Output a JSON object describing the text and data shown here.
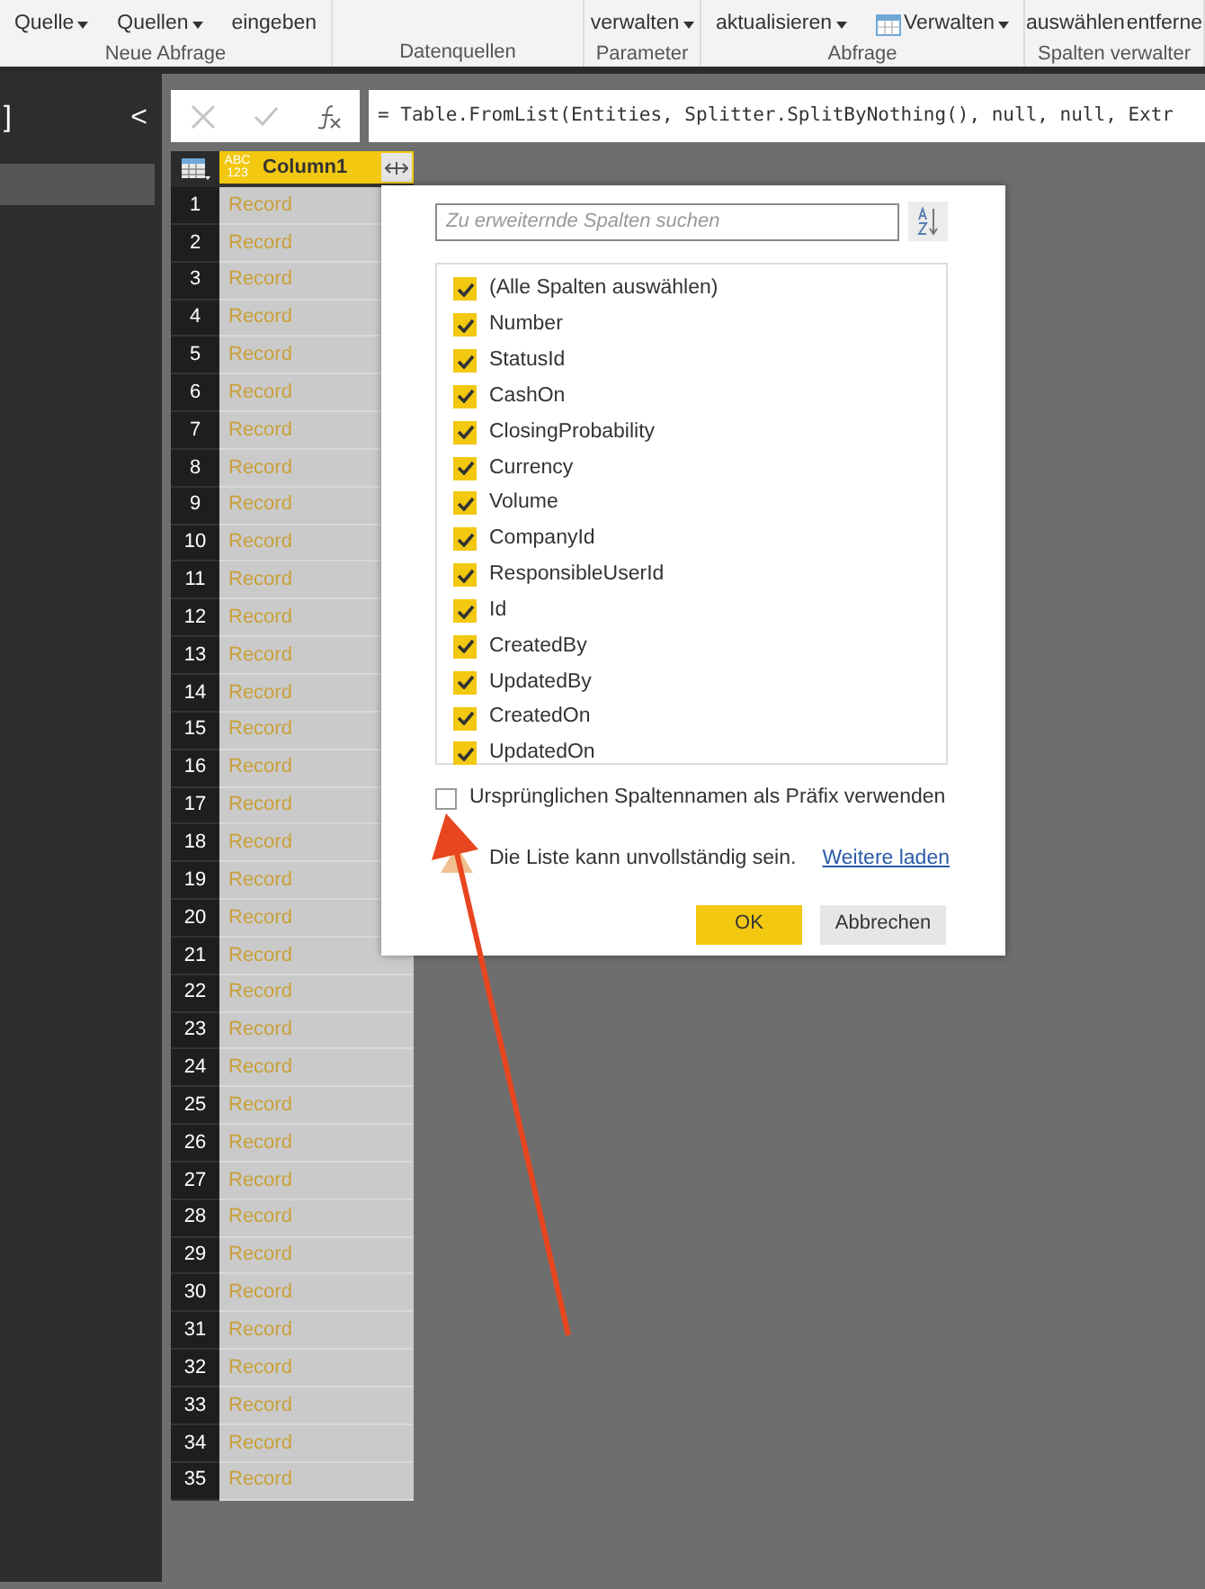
{
  "ribbon": {
    "groups": [
      {
        "label": "Neue Abfrage",
        "buttons": [
          {
            "label": "Quelle",
            "dropdown": true
          },
          {
            "label": "Quellen",
            "dropdown": true
          },
          {
            "label": "eingeben",
            "dropdown": false
          }
        ]
      },
      {
        "label": "Datenquellen"
      },
      {
        "label": "Parameter",
        "buttons": [
          {
            "label": "verwalten",
            "dropdown": true
          }
        ]
      },
      {
        "label": "Abfrage",
        "buttons": [
          {
            "label": "aktualisieren",
            "dropdown": true
          },
          {
            "label": "Verwalten",
            "dropdown": true
          }
        ]
      },
      {
        "label": "Spalten verwalter",
        "buttons": [
          {
            "label": "auswählen",
            "dropdown": false
          },
          {
            "label": "entferne",
            "dropdown": false
          }
        ]
      }
    ]
  },
  "queries_pane": {
    "bracket": "]",
    "collapse": "<"
  },
  "formula_bar": {
    "formula": "= Table.FromList(Entities, Splitter.SplitByNothing(), null, null, Extr"
  },
  "table": {
    "column": {
      "type_label": "ABC 123",
      "name": "Column1"
    },
    "rows": [
      {
        "number": "1",
        "value": "Record"
      },
      {
        "number": "2",
        "value": "Record"
      },
      {
        "number": "3",
        "value": "Record"
      },
      {
        "number": "4",
        "value": "Record"
      },
      {
        "number": "5",
        "value": "Record"
      },
      {
        "number": "6",
        "value": "Record"
      },
      {
        "number": "7",
        "value": "Record"
      },
      {
        "number": "8",
        "value": "Record"
      },
      {
        "number": "9",
        "value": "Record"
      },
      {
        "number": "10",
        "value": "Record"
      },
      {
        "number": "11",
        "value": "Record"
      },
      {
        "number": "12",
        "value": "Record"
      },
      {
        "number": "13",
        "value": "Record"
      },
      {
        "number": "14",
        "value": "Record"
      },
      {
        "number": "15",
        "value": "Record"
      },
      {
        "number": "16",
        "value": "Record"
      },
      {
        "number": "17",
        "value": "Record"
      },
      {
        "number": "18",
        "value": "Record"
      },
      {
        "number": "19",
        "value": "Record"
      },
      {
        "number": "20",
        "value": "Record"
      },
      {
        "number": "21",
        "value": "Record"
      },
      {
        "number": "22",
        "value": "Record"
      },
      {
        "number": "23",
        "value": "Record"
      },
      {
        "number": "24",
        "value": "Record"
      },
      {
        "number": "25",
        "value": "Record"
      },
      {
        "number": "26",
        "value": "Record"
      },
      {
        "number": "27",
        "value": "Record"
      },
      {
        "number": "28",
        "value": "Record"
      },
      {
        "number": "29",
        "value": "Record"
      },
      {
        "number": "30",
        "value": "Record"
      },
      {
        "number": "31",
        "value": "Record"
      },
      {
        "number": "32",
        "value": "Record"
      },
      {
        "number": "33",
        "value": "Record"
      },
      {
        "number": "34",
        "value": "Record"
      },
      {
        "number": "35",
        "value": "Record"
      }
    ]
  },
  "expand_dialog": {
    "search": {
      "placeholder": "Zu erweiternde Spalten suchen"
    },
    "columns": [
      {
        "label": "(Alle Spalten auswählen)",
        "checked": true
      },
      {
        "label": "Number",
        "checked": true
      },
      {
        "label": "StatusId",
        "checked": true
      },
      {
        "label": "CashOn",
        "checked": true
      },
      {
        "label": "ClosingProbability",
        "checked": true
      },
      {
        "label": "Currency",
        "checked": true
      },
      {
        "label": "Volume",
        "checked": true
      },
      {
        "label": "CompanyId",
        "checked": true
      },
      {
        "label": "ResponsibleUserId",
        "checked": true
      },
      {
        "label": "Id",
        "checked": true
      },
      {
        "label": "CreatedBy",
        "checked": true
      },
      {
        "label": "UpdatedBy",
        "checked": true
      },
      {
        "label": "CreatedOn",
        "checked": true
      },
      {
        "label": "UpdatedOn",
        "checked": true
      }
    ],
    "prefix_option": {
      "label": "Ursprünglichen Spaltennamen als Präfix verwenden",
      "checked": false
    },
    "warning": "Die Liste kann unvollständig sein.",
    "load_more": "Weitere laden",
    "buttons": [
      {
        "label": "OK",
        "kind": "primary"
      },
      {
        "label": "Abbrechen",
        "kind": "secondary"
      }
    ]
  }
}
